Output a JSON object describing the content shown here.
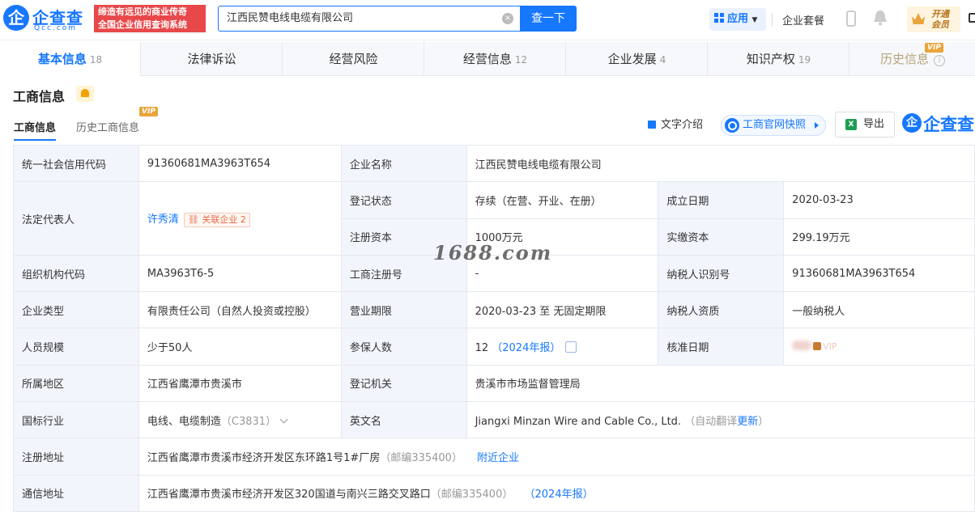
{
  "header": {
    "logo_mark": "企",
    "logo_text": "企查查",
    "logo_sub": "Qcc.com",
    "slogan_line1": "缔造有远见的商业传奇",
    "slogan_line2": "全国企业信用查询系统",
    "search_value": "江西民赞电线电缆有限公司",
    "search_button": "查一下",
    "app_label": "应用",
    "package_link": "企业套餐",
    "vip_line1": "开通",
    "vip_line2": "会员"
  },
  "tabs": [
    {
      "label": "基本信息",
      "count": "18"
    },
    {
      "label": "法律诉讼",
      "count": ""
    },
    {
      "label": "经营风险",
      "count": ""
    },
    {
      "label": "经营信息",
      "count": "12"
    },
    {
      "label": "企业发展",
      "count": "4"
    },
    {
      "label": "知识产权",
      "count": "19"
    },
    {
      "label": "历史信息",
      "count": ""
    }
  ],
  "vip_badge": "VIP",
  "section": {
    "title": "工商信息",
    "subtab_active": "工商信息",
    "subtab_history": "历史工商信息",
    "text_intro": "文字介绍",
    "snapshot": "工商官网快照",
    "export": "导出",
    "brand_text": "企查查"
  },
  "watermark": "1688.com",
  "table": {
    "credit_code_k": "统一社会信用代码",
    "credit_code_v": "91360681MA3963T654",
    "company_name_k": "企业名称",
    "company_name_v": "江西民赞电线电缆有限公司",
    "legal_rep_k": "法定代表人",
    "legal_rep_v": "许秀清",
    "related_label": "关联企业",
    "related_count": "2",
    "reg_status_k": "登记状态",
    "reg_status_v": "存续（在营、开业、在册）",
    "est_date_k": "成立日期",
    "est_date_v": "2020-03-23",
    "reg_capital_k": "注册资本",
    "reg_capital_v": "1000万元",
    "paid_capital_k": "实缴资本",
    "paid_capital_v": "299.19万元",
    "org_code_k": "组织机构代码",
    "org_code_v": "MA3963T6-5",
    "biz_reg_no_k": "工商注册号",
    "biz_reg_no_v": "-",
    "taxpayer_id_k": "纳税人识别号",
    "taxpayer_id_v": "91360681MA3963T654",
    "ent_type_k": "企业类型",
    "ent_type_v": "有限责任公司（自然人投资或控股）",
    "biz_term_k": "营业期限",
    "biz_term_v": "2020-03-23 至 无固定期限",
    "taxpayer_qual_k": "纳税人资质",
    "taxpayer_qual_v": "一般纳税人",
    "staff_size_k": "人员规模",
    "staff_size_v": "少于50人",
    "insured_k": "参保人数",
    "insured_v": "12",
    "insured_report": "（2024年报）",
    "approve_date_k": "核准日期",
    "approve_vip": "VIP",
    "region_k": "所属地区",
    "region_v": "江西省鹰潭市贵溪市",
    "reg_authority_k": "登记机关",
    "reg_authority_v": "贵溪市市场监督管理局",
    "industry_k": "国标行业",
    "industry_v": "电线、电缆制造",
    "industry_code": "（C3831）",
    "en_name_k": "英文名",
    "en_name_v": "Jiangxi Minzan Wire and Cable Co., Ltd.",
    "en_name_note": "（自动翻译",
    "en_name_update": "更新",
    "en_name_close": "）",
    "reg_addr_k": "注册地址",
    "reg_addr_v": "江西省鹰潭市贵溪市经济开发区东环路1号1#厂房",
    "reg_addr_zip": "（邮编335400）",
    "nearby": "附近企业",
    "mail_addr_k": "通信地址",
    "mail_addr_v": "江西省鹰潭市贵溪市经济开发区320国道与南兴三路交叉路口",
    "mail_addr_zip": "（邮编335400）",
    "mail_addr_report": "（2024年报）"
  }
}
